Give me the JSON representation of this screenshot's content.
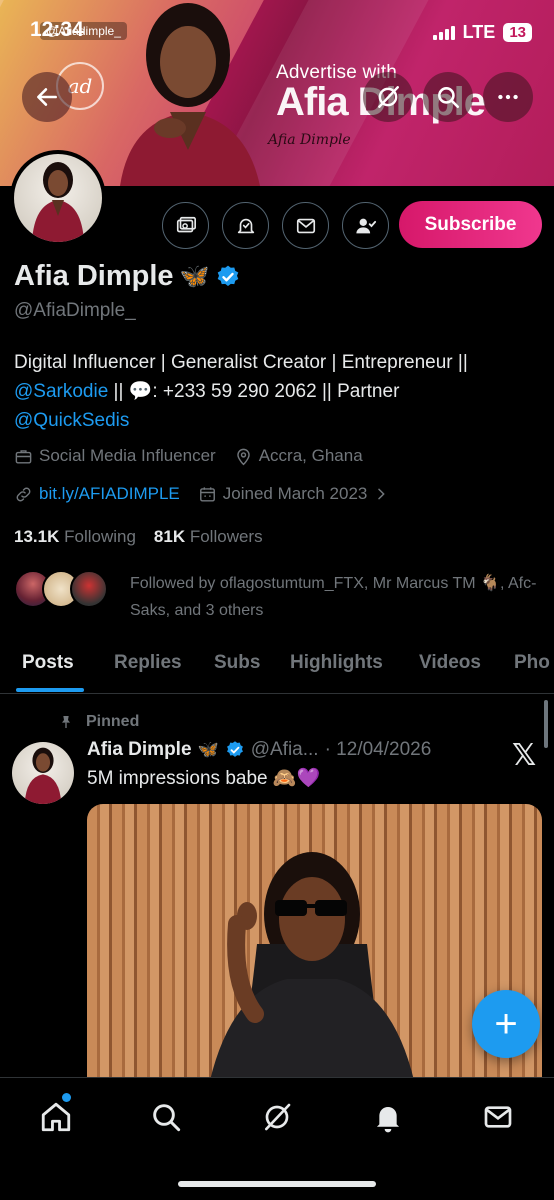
{
  "status_bar": {
    "time": "12:34",
    "network": "LTE",
    "battery": "13"
  },
  "banner": {
    "handle_overlay": "@Afiadimple_",
    "advertise_small": "Advertise with",
    "advertise_big": "Afia Dimple",
    "signature": "Afia Dimple",
    "logo_text": "ad"
  },
  "profile": {
    "name": "Afia Dimple",
    "name_emoji": "🦋",
    "handle": "@AfiaDimple_",
    "subscribe_label": "Subscribe",
    "bio": {
      "line1": "Digital Influencer | Generalist Creator | Entrepreneur ||",
      "mention1": "@Sarkodie",
      "mid": " || 💬: +233 59 290 2062 || Partner",
      "mention2": "@QuickSedis"
    },
    "category": "Social Media Influencer",
    "location": "Accra, Ghana",
    "website": "bit.ly/AFIADIMPLE",
    "joined": "Joined March 2023",
    "following_count": "13.1K",
    "following_label": "Following",
    "followers_count": "81K",
    "followers_label": "Followers",
    "followed_by": "Followed by oflagostumtum_FTX, Mr Marcus TM 🐐, Afc-Saks, and 3 others"
  },
  "tabs": [
    "Posts",
    "Replies",
    "Subs",
    "Highlights",
    "Videos",
    "Pho"
  ],
  "post": {
    "pinned_label": "Pinned",
    "author": "Afia Dimple",
    "author_emoji": "🦋",
    "handle": "@Afia...",
    "date": "· 12/04/2026",
    "text": "5M impressions babe 🙈💜"
  },
  "fab_label": "+",
  "colors": {
    "accent": "#1d9bf0",
    "subscribe": "#e0247a",
    "background": "#000000"
  }
}
